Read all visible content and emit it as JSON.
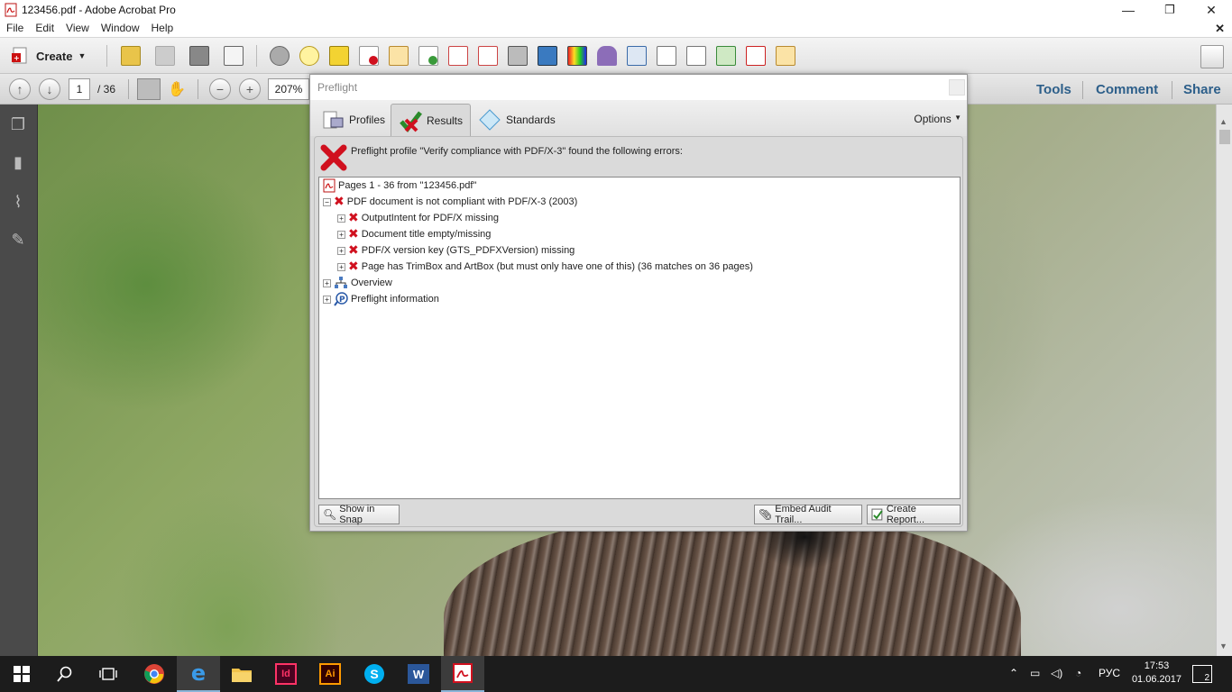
{
  "window": {
    "title": "123456.pdf - Adobe Acrobat Pro",
    "minimize": "—",
    "maximize": "❐",
    "close": "✕"
  },
  "menu": {
    "items": [
      "File",
      "Edit",
      "View",
      "Window",
      "Help"
    ],
    "close_doc": "✕"
  },
  "toolbar": {
    "create_label": "Create",
    "icons": [
      "open-icon",
      "save-icon",
      "print-icon",
      "email-icon",
      "settings-icon",
      "comment-icon",
      "highlight-icon",
      "delete-icon",
      "export-icon",
      "combine-icon",
      "extract-icon",
      "redact-icon",
      "preflight-icon",
      "stamp-icon",
      "color-icon",
      "ink-icon",
      "convert-icon",
      "crop-icon",
      "edit-icon",
      "upload-icon",
      "acrobat-icon",
      "forms-icon"
    ],
    "expand_icon": "expand-icon"
  },
  "nav": {
    "page_current": "1",
    "page_total": "/ 36",
    "zoom": "207%",
    "tools": "Tools",
    "comment": "Comment",
    "share": "Share"
  },
  "preflight": {
    "title": "Preflight",
    "tabs": [
      "Profiles",
      "Results",
      "Standards"
    ],
    "active_tab": "Results",
    "options": "Options",
    "message": "Preflight profile \"Verify compliance with PDF/X-3\" found the following errors:",
    "tree": [
      {
        "text": "Pages 1 - 36 from \"123456.pdf\"",
        "level": 0,
        "expander": ""
      },
      {
        "text": "PDF document is not compliant with PDF/X-3 (2003)",
        "level": 0,
        "expander": "−"
      },
      {
        "text": "OutputIntent for PDF/X missing",
        "level": 1,
        "expander": "+"
      },
      {
        "text": "Document title empty/missing",
        "level": 1,
        "expander": "+"
      },
      {
        "text": "PDF/X version key (GTS_PDFXVersion) missing",
        "level": 1,
        "expander": "+"
      },
      {
        "text": "Page has TrimBox and ArtBox (but must only have one of this) (36 matches on 36 pages)",
        "level": 1,
        "expander": "+"
      },
      {
        "text": "Overview",
        "level": 0,
        "expander": "+"
      },
      {
        "text": "Preflight information",
        "level": 0,
        "expander": "+"
      }
    ],
    "buttons": {
      "show_in_snap": "Show in Snap",
      "embed_audit": "Embed Audit Trail...",
      "create_report": "Create Report..."
    }
  },
  "taskbar": {
    "apps": [
      "chrome-icon",
      "edge-icon",
      "explorer-icon",
      "indesign-icon",
      "illustrator-icon",
      "skype-icon",
      "word-icon",
      "acrobat-icon"
    ],
    "lang": "РУС",
    "time": "17:53",
    "date": "01.06.2017",
    "notifications": "2"
  },
  "colors": {
    "error_red": "#d0101e",
    "link_blue": "#2d5f8a",
    "taskbar": "#1c1c1c"
  }
}
